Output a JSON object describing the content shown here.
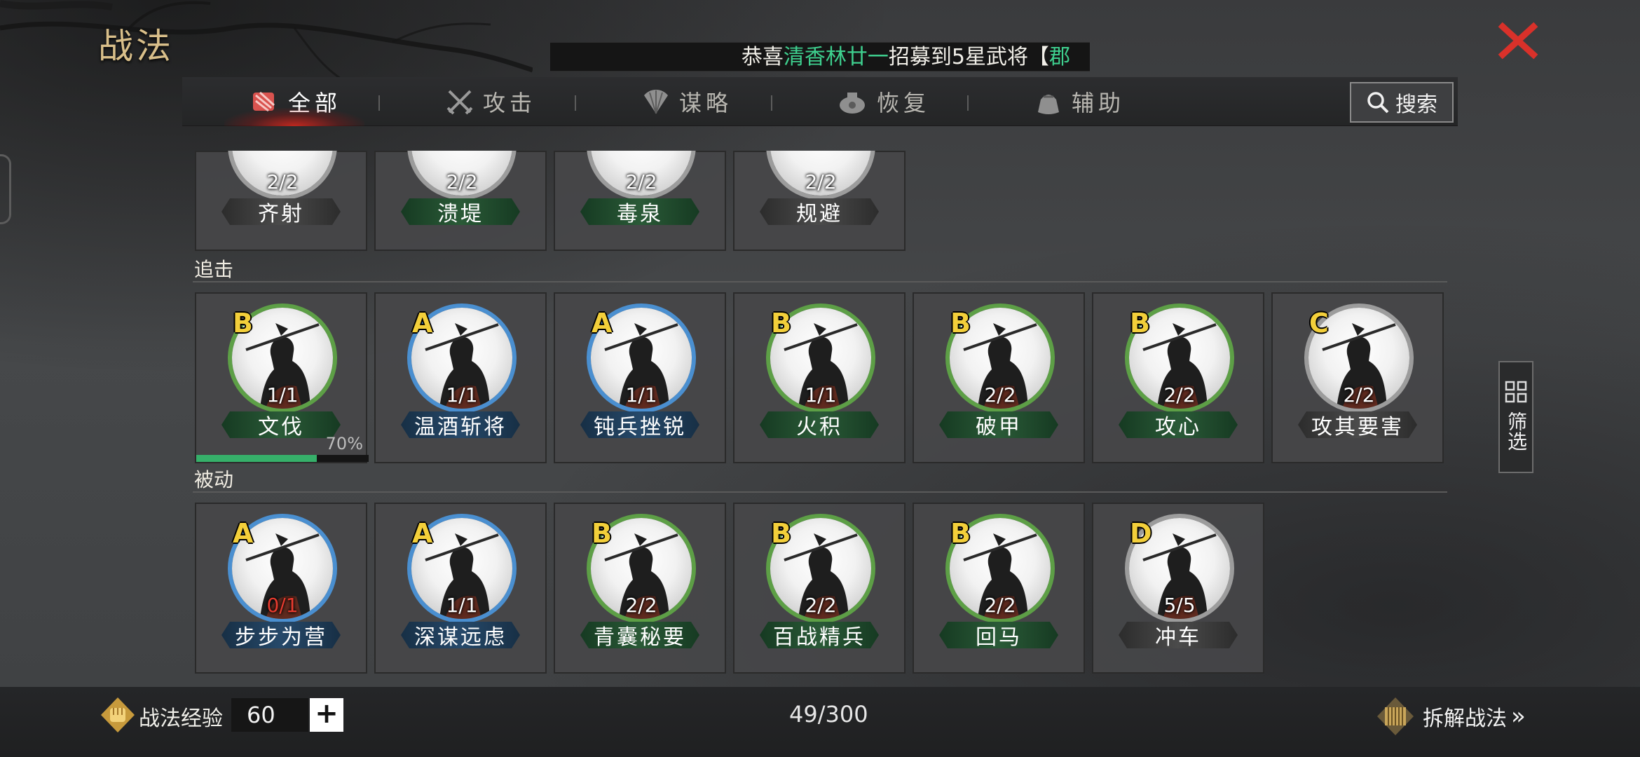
{
  "page": {
    "title": "战法",
    "close_icon": "close-x-icon"
  },
  "marquee": {
    "prefix": "恭喜",
    "player": "清香林廿一",
    "suffix": "招募到5星武将【",
    "tail": "郡"
  },
  "tabs": [
    {
      "label": "全部",
      "icon": "all-scroll-icon",
      "active": true
    },
    {
      "label": "攻击",
      "icon": "crossed-swords-icon",
      "active": false
    },
    {
      "label": "谋略",
      "icon": "strategy-fan-icon",
      "active": false
    },
    {
      "label": "恢复",
      "icon": "recovery-pot-icon",
      "active": false
    },
    {
      "label": "辅助",
      "icon": "support-bag-icon",
      "active": false
    }
  ],
  "search": {
    "label": "搜索",
    "icon": "search-icon"
  },
  "filter": {
    "label": "筛选",
    "icon": "grid-filter-icon"
  },
  "partial_row": [
    {
      "count": "2/2",
      "name": "齐射"
    },
    {
      "count": "2/2",
      "name": "溃堤"
    },
    {
      "count": "2/2",
      "name": "毒泉"
    },
    {
      "count": "2/2",
      "name": "规避"
    }
  ],
  "sections": [
    {
      "label": "追击",
      "cards": [
        {
          "grade": "B",
          "count": "1/1",
          "name": "文伐",
          "ring": "green",
          "progress_label": "70%",
          "progress": 0.7
        },
        {
          "grade": "A",
          "count": "1/1",
          "name": "温酒斩将",
          "ring": "blue"
        },
        {
          "grade": "A",
          "count": "1/1",
          "name": "钝兵挫锐",
          "ring": "blue"
        },
        {
          "grade": "B",
          "count": "1/1",
          "name": "火积",
          "ring": "green"
        },
        {
          "grade": "B",
          "count": "2/2",
          "name": "破甲",
          "ring": "green"
        },
        {
          "grade": "B",
          "count": "2/2",
          "name": "攻心",
          "ring": "green"
        },
        {
          "grade": "C",
          "count": "2/2",
          "name": "攻其要害",
          "ring": "gray"
        }
      ]
    },
    {
      "label": "被动",
      "cards": [
        {
          "grade": "A",
          "count": "0/1",
          "name": "步步为营",
          "ring": "blue",
          "count_color": "red"
        },
        {
          "grade": "A",
          "count": "1/1",
          "name": "深谋远虑",
          "ring": "blue"
        },
        {
          "grade": "B",
          "count": "2/2",
          "name": "青囊秘要",
          "ring": "green"
        },
        {
          "grade": "B",
          "count": "2/2",
          "name": "百战精兵",
          "ring": "green"
        },
        {
          "grade": "B",
          "count": "2/2",
          "name": "回马",
          "ring": "green"
        },
        {
          "grade": "D",
          "count": "5/5",
          "name": "冲车",
          "ring": "gray"
        }
      ]
    }
  ],
  "footer": {
    "exp_label": "战法经验",
    "exp_value": "60",
    "plus": "+",
    "capacity": "49/300",
    "disassemble_label": "拆解战法",
    "disassemble_arrow": "»"
  }
}
